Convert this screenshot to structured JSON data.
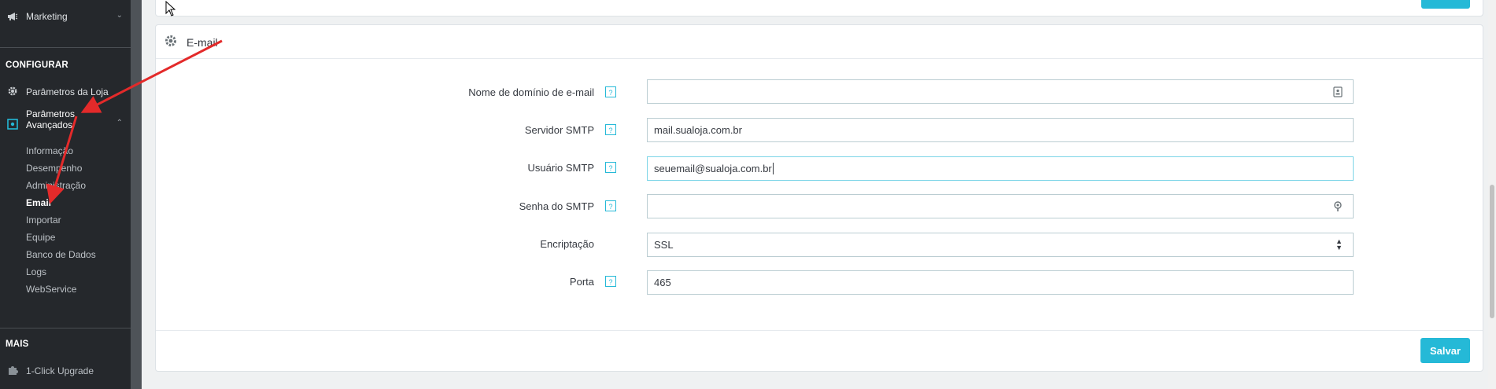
{
  "sidebar": {
    "top_item": {
      "label": "Marketing",
      "icon": "megaphone-icon"
    },
    "configure_title": "CONFIGURAR",
    "store_params": {
      "label": "Parâmetros da Loja",
      "icon": "gear-icon"
    },
    "advanced_params": {
      "label_line1": "Parâmetros",
      "label_line2": "Avançados",
      "icon": "settings-box-icon"
    },
    "subitems": [
      "Informação",
      "Desempenho",
      "Administração",
      "Email",
      "Importar",
      "Equipe",
      "Banco de Dados",
      "Logs",
      "WebService"
    ],
    "active_subitem": "Email",
    "more_title": "MAIS",
    "upgrade": {
      "label": "1-Click Upgrade",
      "icon": "puzzle-icon"
    }
  },
  "card": {
    "title": "E-mail",
    "help_glyph": "?",
    "fields": {
      "domain": {
        "label": "Nome de domínio de e-mail",
        "value": ""
      },
      "smtp_server": {
        "label": "Servidor SMTP",
        "value": "mail.sualoja.com.br"
      },
      "smtp_user": {
        "label": "Usuário SMTP",
        "value": "seuemail@sualoja.com.br"
      },
      "smtp_password": {
        "label": "Senha do SMTP",
        "value": ""
      },
      "encryption": {
        "label": "Encriptação",
        "value": "SSL"
      },
      "port": {
        "label": "Porta",
        "value": "465"
      }
    },
    "save_label": "Salvar"
  },
  "colors": {
    "accent": "#25b9d7",
    "sidebar_bg": "#25282c",
    "annotation_arrow": "#e32a2a"
  }
}
